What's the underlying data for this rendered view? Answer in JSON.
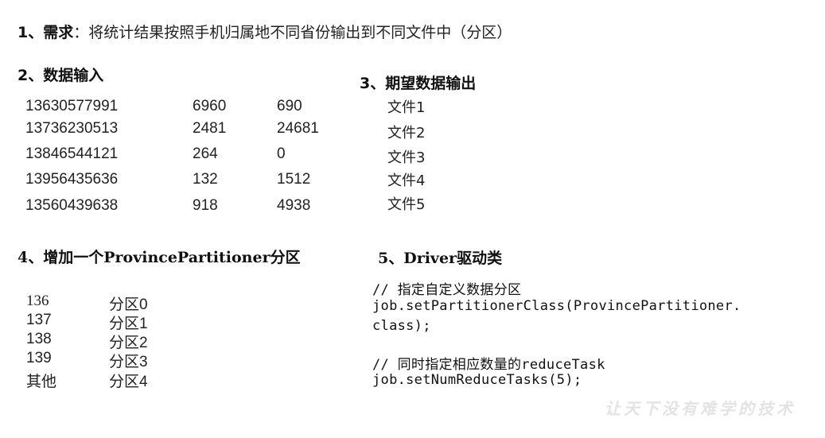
{
  "section1": {
    "label": "1、需求",
    "colon": "：",
    "text": "将统计结果按照手机归属地不同省份输出到不同文件中（分区）"
  },
  "section2": {
    "title": "2、数据输入",
    "rows": [
      {
        "phone": "13630577991",
        "up": "6960",
        "down": "690"
      },
      {
        "phone": "13736230513",
        "up": "2481",
        "down": "24681"
      },
      {
        "phone": "13846544121",
        "up": "264",
        "down": "0"
      },
      {
        "phone": "13956435636",
        "up": "132",
        "down": "1512"
      },
      {
        "phone": "13560439638",
        "up": "918",
        "down": "4938"
      }
    ]
  },
  "section3": {
    "title": "3、期望数据输出",
    "files": [
      "文件1",
      "文件2",
      "文件3",
      "文件4",
      "文件5"
    ]
  },
  "section4": {
    "title": "4、增加一个ProvincePartitioner分区",
    "rows": [
      {
        "prefix": "136",
        "partition": "分区0"
      },
      {
        "prefix": "137",
        "partition": "分区1"
      },
      {
        "prefix": "138",
        "partition": "分区2"
      },
      {
        "prefix": "139",
        "partition": "分区3"
      },
      {
        "prefix": "其他",
        "partition": "分区4"
      }
    ]
  },
  "section5": {
    "title": "5、Driver驱动类",
    "code": [
      "// 指定自定义数据分区",
      "job.setPartitionerClass(ProvincePartitioner.",
      "class);",
      "// 同时指定相应数量的reduceTask",
      "job.setNumReduceTasks(5);"
    ]
  },
  "watermark": "让天下没有难学的技术"
}
